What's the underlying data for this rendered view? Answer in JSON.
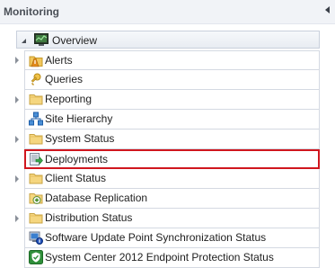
{
  "pane": {
    "title": "Monitoring",
    "collapse_icon": "chevron-left-icon"
  },
  "tree": {
    "root": {
      "label": "Overview",
      "icon": "monitor-overview-icon",
      "expanded": true
    },
    "items": [
      {
        "label": "Alerts",
        "icon": "alert-folder-icon",
        "has_children": true,
        "selected": false
      },
      {
        "label": "Queries",
        "icon": "query-key-icon",
        "has_children": false,
        "selected": false
      },
      {
        "label": "Reporting",
        "icon": "folder-icon",
        "has_children": true,
        "selected": false
      },
      {
        "label": "Site Hierarchy",
        "icon": "site-hierarchy-icon",
        "has_children": false,
        "selected": false
      },
      {
        "label": "System Status",
        "icon": "folder-icon",
        "has_children": true,
        "selected": false
      },
      {
        "label": "Deployments",
        "icon": "deployment-icon",
        "has_children": false,
        "selected": true
      },
      {
        "label": "Client Status",
        "icon": "folder-icon",
        "has_children": true,
        "selected": false
      },
      {
        "label": "Database Replication",
        "icon": "database-replication-icon",
        "has_children": false,
        "selected": false
      },
      {
        "label": "Distribution Status",
        "icon": "folder-icon",
        "has_children": true,
        "selected": false
      },
      {
        "label": "Software Update Point Synchronization Status",
        "icon": "update-sync-icon",
        "has_children": false,
        "selected": false
      },
      {
        "label": "System Center 2012 Endpoint Protection Status",
        "icon": "endpoint-protection-icon",
        "has_children": false,
        "selected": false
      }
    ]
  },
  "colors": {
    "selection_border": "#d0161e",
    "header_bg": "#f1f3f7",
    "row_border": "#d4d9e2",
    "folder_fill": "#f2d27a"
  }
}
